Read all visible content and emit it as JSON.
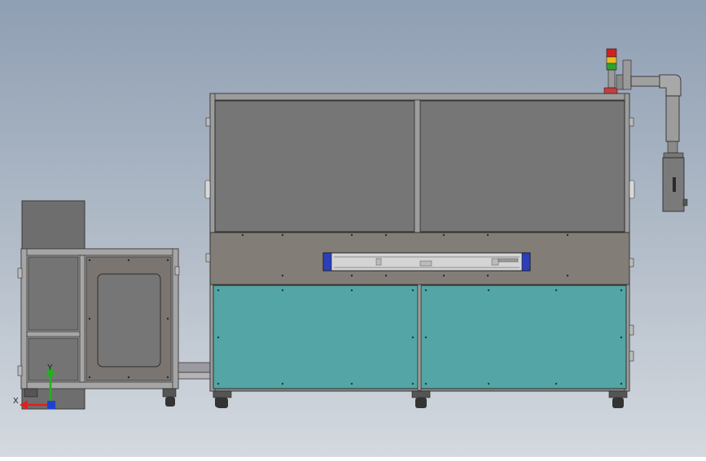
{
  "view": {
    "background_top": "#8f9fb3",
    "background_bottom": "#d4d9df"
  },
  "triad": {
    "x_label": "X",
    "y_label": "Y",
    "x_color": "#e02020",
    "y_color": "#22b022",
    "z_color": "#2040d0"
  },
  "colors": {
    "frame": "#8c8c8c",
    "window_panel": "#767676",
    "middle_band": "#837d78",
    "lower_panels": "#54a5a5",
    "enclosure_panel": "#7a7570",
    "stack_light_red": "#d02020",
    "stack_light_yellow": "#e0c020",
    "stack_light_green": "#30a030",
    "accent_blue": "#2a3fb8"
  }
}
